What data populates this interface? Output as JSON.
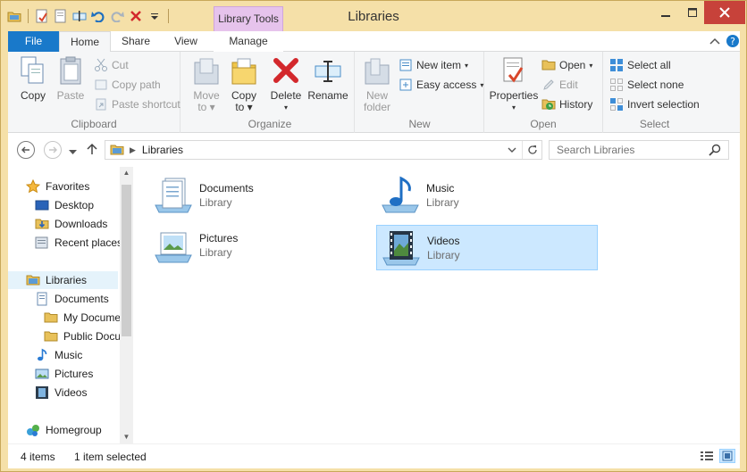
{
  "window": {
    "title": "Libraries",
    "context_tab_label": "Library Tools"
  },
  "tabs": {
    "file": "File",
    "home": "Home",
    "share": "Share",
    "view": "View",
    "manage": "Manage"
  },
  "ribbon": {
    "clipboard": {
      "label": "Clipboard",
      "copy": "Copy",
      "paste": "Paste",
      "cut": "Cut",
      "copy_path": "Copy path",
      "paste_shortcut": "Paste shortcut"
    },
    "organize": {
      "label": "Organize",
      "move_to_1": "Move",
      "move_to_2": "to",
      "copy_to_1": "Copy",
      "copy_to_2": "to",
      "delete": "Delete",
      "rename": "Rename"
    },
    "new": {
      "label": "New",
      "new_folder_1": "New",
      "new_folder_2": "folder",
      "new_item": "New item",
      "easy_access": "Easy access"
    },
    "open": {
      "label": "Open",
      "properties": "Properties",
      "open": "Open",
      "edit": "Edit",
      "history": "History"
    },
    "select": {
      "label": "Select",
      "select_all": "Select all",
      "select_none": "Select none",
      "invert_selection": "Invert selection"
    }
  },
  "address": {
    "crumb": "Libraries",
    "search_placeholder": "Search Libraries"
  },
  "nav": {
    "favorites": "Favorites",
    "desktop": "Desktop",
    "downloads": "Downloads",
    "recent_places": "Recent places",
    "libraries": "Libraries",
    "documents": "Documents",
    "my_documents": "My Documents",
    "public_documents": "Public Documents",
    "music": "Music",
    "pictures": "Pictures",
    "videos": "Videos",
    "homegroup": "Homegroup"
  },
  "libraries": [
    {
      "name": "Documents",
      "type": "Library",
      "icon": "documents-library-icon"
    },
    {
      "name": "Music",
      "type": "Library",
      "icon": "music-library-icon"
    },
    {
      "name": "Pictures",
      "type": "Library",
      "icon": "pictures-library-icon"
    },
    {
      "name": "Videos",
      "type": "Library",
      "icon": "videos-library-icon",
      "selected": true
    }
  ],
  "status": {
    "item_count": "4 items",
    "selection": "1 item selected"
  },
  "colors": {
    "accent": "#1979ca",
    "frame": "#f5e0a8",
    "selection": "#cce8ff",
    "context_tab": "#e6c3ec",
    "close": "#c7423a"
  }
}
